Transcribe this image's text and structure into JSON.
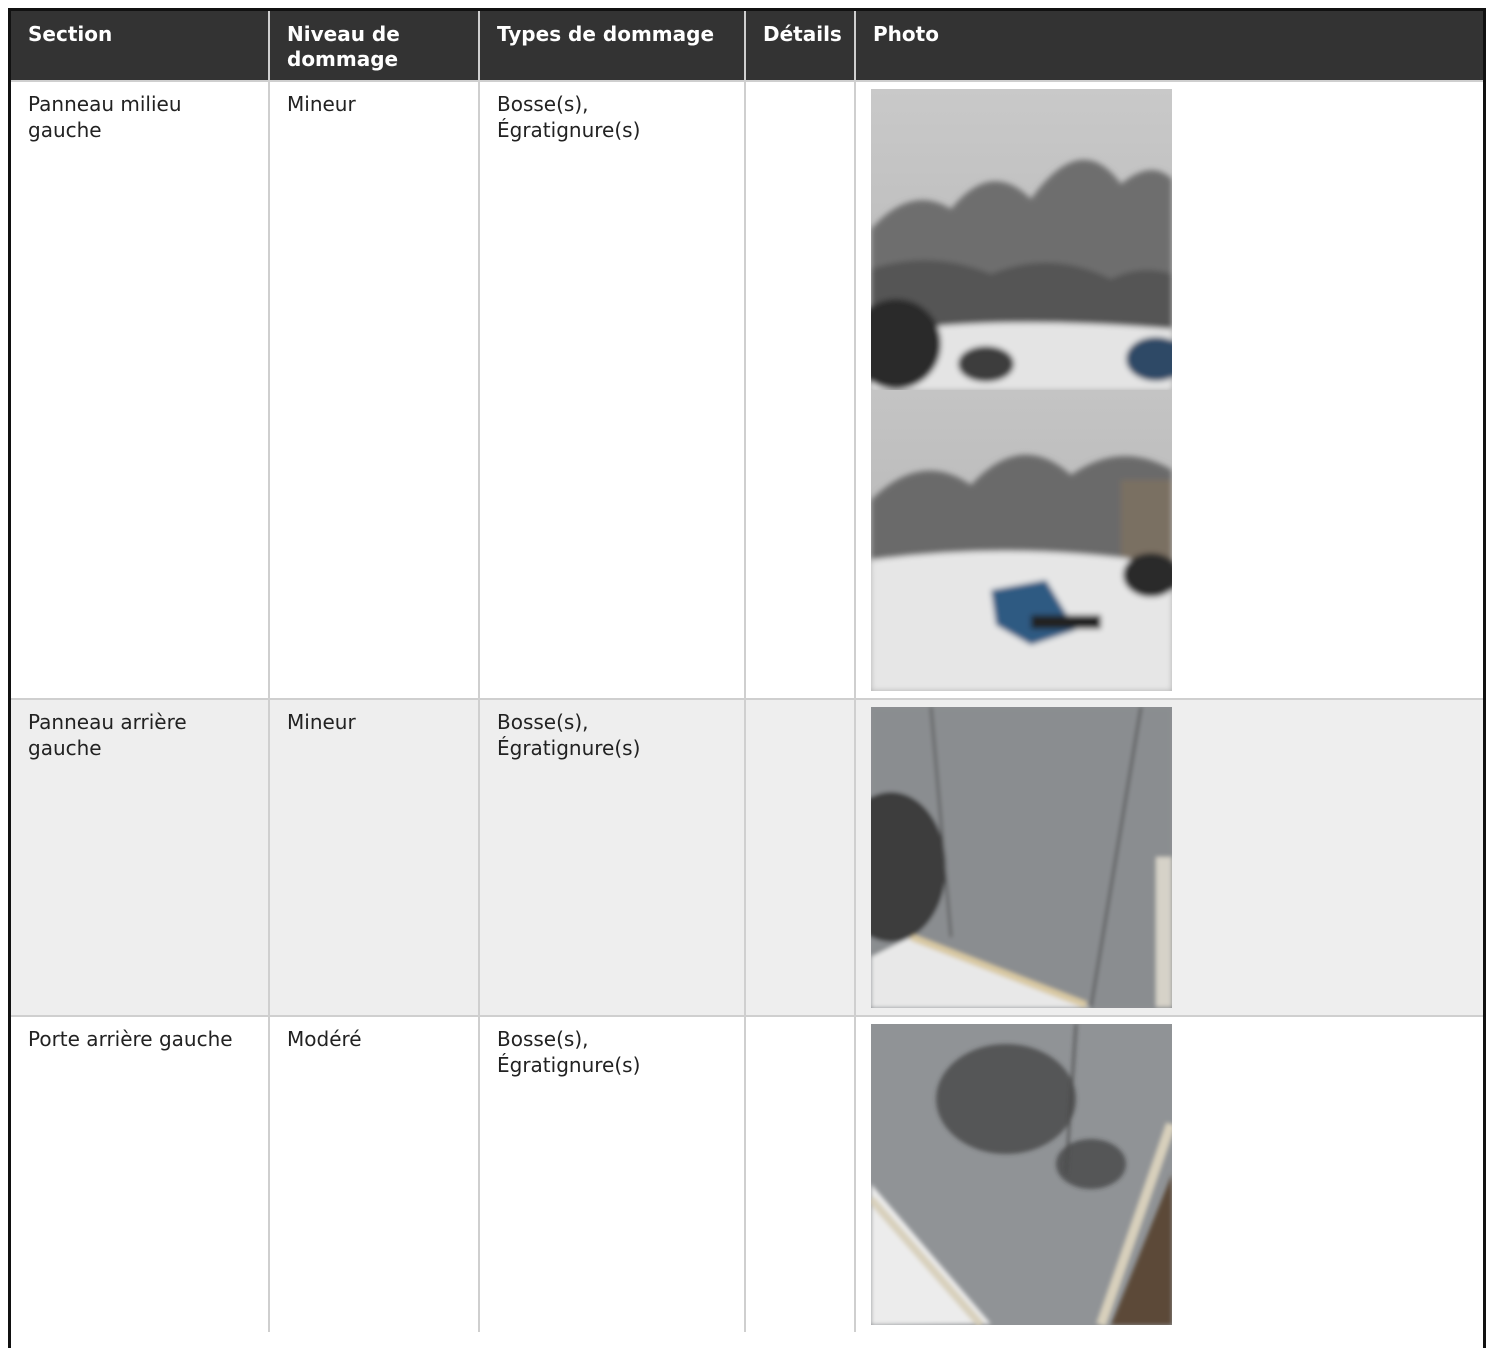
{
  "table": {
    "headers": {
      "section": "Section",
      "niveau": "Niveau de dommage",
      "types": "Types de dommage",
      "details": "Détails",
      "photo": "Photo"
    },
    "rows": [
      {
        "section": "Panneau milieu gauche",
        "niveau": "Mineur",
        "types": "Bosse(s), Égratignure(s)",
        "details": "",
        "photos": [
          "snowmobile-photo",
          "snowmobile-photo"
        ]
      },
      {
        "section": "Panneau arrière gauche",
        "niveau": "Mineur",
        "types": "Bosse(s), Égratignure(s)",
        "details": "",
        "photos": [
          "trailer-panel-photo"
        ]
      },
      {
        "section": "Porte arrière gauche",
        "niveau": "Modéré",
        "types": "Bosse(s), Égratignure(s)",
        "details": "",
        "photos": [
          "trailer-door-photo"
        ]
      }
    ]
  }
}
